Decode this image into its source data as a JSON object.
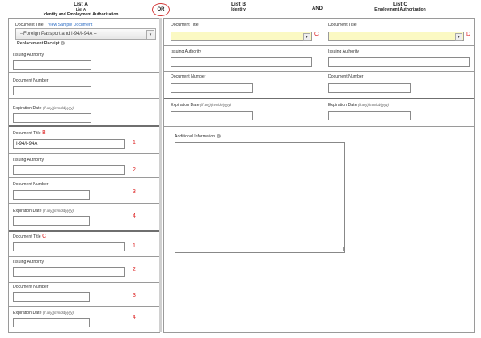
{
  "header": {
    "listA": {
      "title": "List A",
      "subtitle": "List A",
      "caption": "Identity and Employment Authorization"
    },
    "or_label": "OR",
    "listB": {
      "title": "List B",
      "caption": "Identity"
    },
    "and_label": "AND",
    "listC": {
      "title": "List C",
      "caption": "Employment Authorization"
    }
  },
  "listA": {
    "doc_title_label": "Document Title",
    "view_sample": "View Sample Document",
    "doc_title_value": "--Foreign Passport and I-94/I-94A --",
    "replacement_receipt": "Replacement Receipt",
    "doc1": {
      "issuing_authority": "Issuing Authority",
      "document_number": "Document Number",
      "expiration_date": "Expiration Date",
      "expiration_hint": "(if any)(mm/dd/yyyy)"
    },
    "doc2": {
      "doc_title_label": "Document Title",
      "marker": "B",
      "doc_title_value": "I-94/I-94A",
      "issuing_authority": "Issuing Authority",
      "document_number": "Document Number",
      "expiration_date": "Expiration Date",
      "expiration_hint": "(if any)(mm/dd/yyyy)",
      "n1": "1",
      "n2": "2",
      "n3": "3",
      "n4": "4"
    },
    "doc3": {
      "doc_title_label": "Document Title",
      "marker": "C",
      "issuing_authority": "Issuing Authority",
      "document_number": "Document Number",
      "expiration_date": "Expiration Date",
      "expiration_hint": "(if any)(mm/dd/yyyy)",
      "n1": "1",
      "n2": "2",
      "n3": "3",
      "n4": "4"
    }
  },
  "listB": {
    "doc_title_label": "Document Title",
    "marker": "C",
    "issuing_authority": "Issuing Authority",
    "document_number": "Document Number",
    "expiration_date": "Expiration Date",
    "expiration_hint": "(if any)(mm/dd/yyyy)"
  },
  "listC": {
    "doc_title_label": "Document Title",
    "marker": "D",
    "issuing_authority": "Issuing Authority",
    "document_number": "Document Number",
    "expiration_date": "Expiration Date",
    "expiration_hint": "(if any)(mm/dd/yyyy)"
  },
  "additional_info": {
    "label": "Additional Information"
  },
  "colors": {
    "highlight_field": "#fbf9c3",
    "marker_red": "#d22222",
    "link_blue": "#2b6cc4"
  }
}
